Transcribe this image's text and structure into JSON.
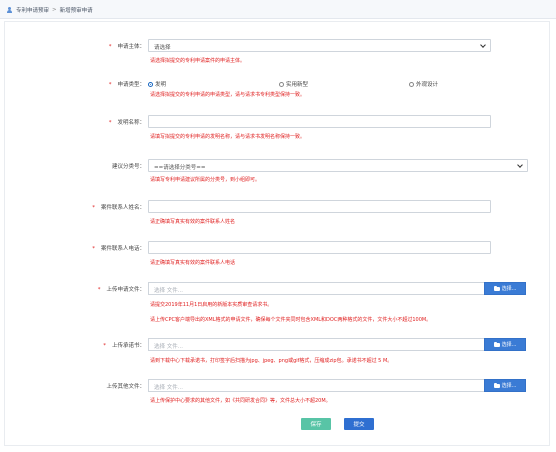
{
  "breadcrumb": {
    "root": "专利申请预审",
    "separator": ">",
    "current": "新增预审申请"
  },
  "form": {
    "applicant": {
      "label": "申请主体：",
      "value": "请选择",
      "hint": "请选择拟提交的专利申请案件的申请主体。"
    },
    "apply_type": {
      "label": "申请类型：",
      "options": [
        "发明",
        "实用新型",
        "外观设计"
      ],
      "selected": "发明",
      "hint": "请选择拟提交的专利申请的申请类型，请与请求书专利类型保持一致。"
    },
    "invention_name": {
      "label": "发明名称：",
      "value": "",
      "hint": "请填写拟提交的专利申请的发明名称，请与请求书发明名称保持一致。"
    },
    "classification": {
      "label": "建议分类号：",
      "value": "==请选择分类号==",
      "hint": "请填写专利申请建议所属的分类号，到小组即可。"
    },
    "contact_name": {
      "label": "案件联系人姓名：",
      "value": "",
      "hint": "请正确填写真实有效的案件联系人姓名"
    },
    "contact_phone": {
      "label": "案件联系人电话：",
      "value": "",
      "hint": "请正确填写真实有效的案件联系人电话"
    },
    "apply_file": {
      "label": "上传申请文件：",
      "placeholder": "选择 文件...",
      "button": "选择...",
      "hint1": "请提交2019年11月1日启用的新版本实质审查请求书。",
      "hint2": "请上传CPC客户端导出的XML格式的申请文件，确保每个文件夹同时包含XML和DOC两种格式的文件，文件大小不超过100M。"
    },
    "commitment": {
      "label": "上传承诺书：",
      "placeholder": "选择 文件...",
      "button": "选择...",
      "hint": "请到下载中心下载承诺书，打印签字后扫描为jpg、jpeg、png或gif格式，压缩成zip包。承诺书不超过 5 M。"
    },
    "other_file": {
      "label": "上传其他文件：",
      "placeholder": "选择 文件...",
      "button": "选择...",
      "hint": "请上传保护中心要求的其他文件，如《共同研发合同》等，文件总大小不超20M。"
    }
  },
  "actions": {
    "save": "保存",
    "submit": "提交"
  },
  "colors": {
    "required": "#e02020",
    "save": "#58c4a6",
    "submit": "#2f6fd1",
    "browse": "#3a7bd5"
  }
}
